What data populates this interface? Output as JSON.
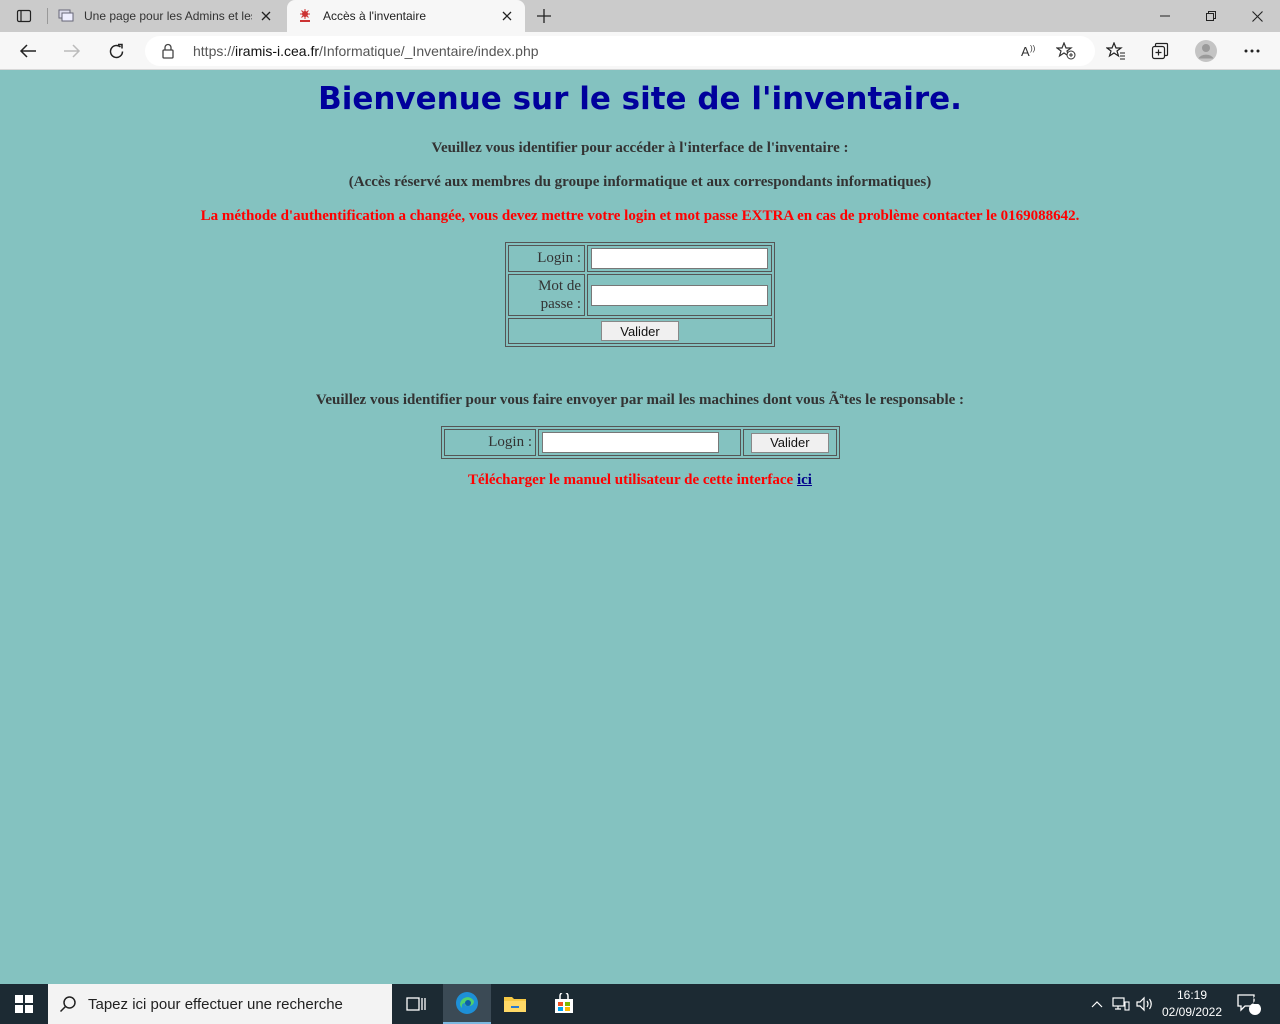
{
  "browser": {
    "tabs": [
      {
        "title": "Une page pour les Admins et les"
      },
      {
        "title": "Accès à l'inventaire"
      }
    ],
    "url_prefix": "https://",
    "url_host": "iramis-i.cea.fr",
    "url_path": "/Informatique/_Inventaire/index.php"
  },
  "page": {
    "title": "Bienvenue sur le site de l'inventaire.",
    "intro": "Veuillez vous identifier pour accéder à l'interface de l'inventaire :",
    "restriction": "(Accès réservé aux membres du groupe informatique et aux correspondants informatiques)",
    "warning": "La méthode d'authentification a changée, vous devez mettre votre login et mot passe EXTRA en cas de problème contacter le 0169088642.",
    "login_form": {
      "login_label": "Login :",
      "password_label_1": "Mot de",
      "password_label_2": "passe :",
      "submit": "Valider"
    },
    "mail_intro": "Veuillez vous identifier pour vous faire envoyer par mail les machines dont vous Ãªtes le responsable :",
    "mail_form": {
      "login_label": "Login :",
      "submit": "Valider"
    },
    "download_text": "Télécharger le manuel utilisateur de cette interface",
    "download_link": "ici"
  },
  "taskbar": {
    "search_placeholder": "Tapez ici pour effectuer une recherche",
    "time": "16:19",
    "date": "02/09/2022",
    "notification_count": "2"
  },
  "colors": {
    "page_background": "#84c2c0",
    "title": "#00009c",
    "warning": "#ff0000"
  }
}
